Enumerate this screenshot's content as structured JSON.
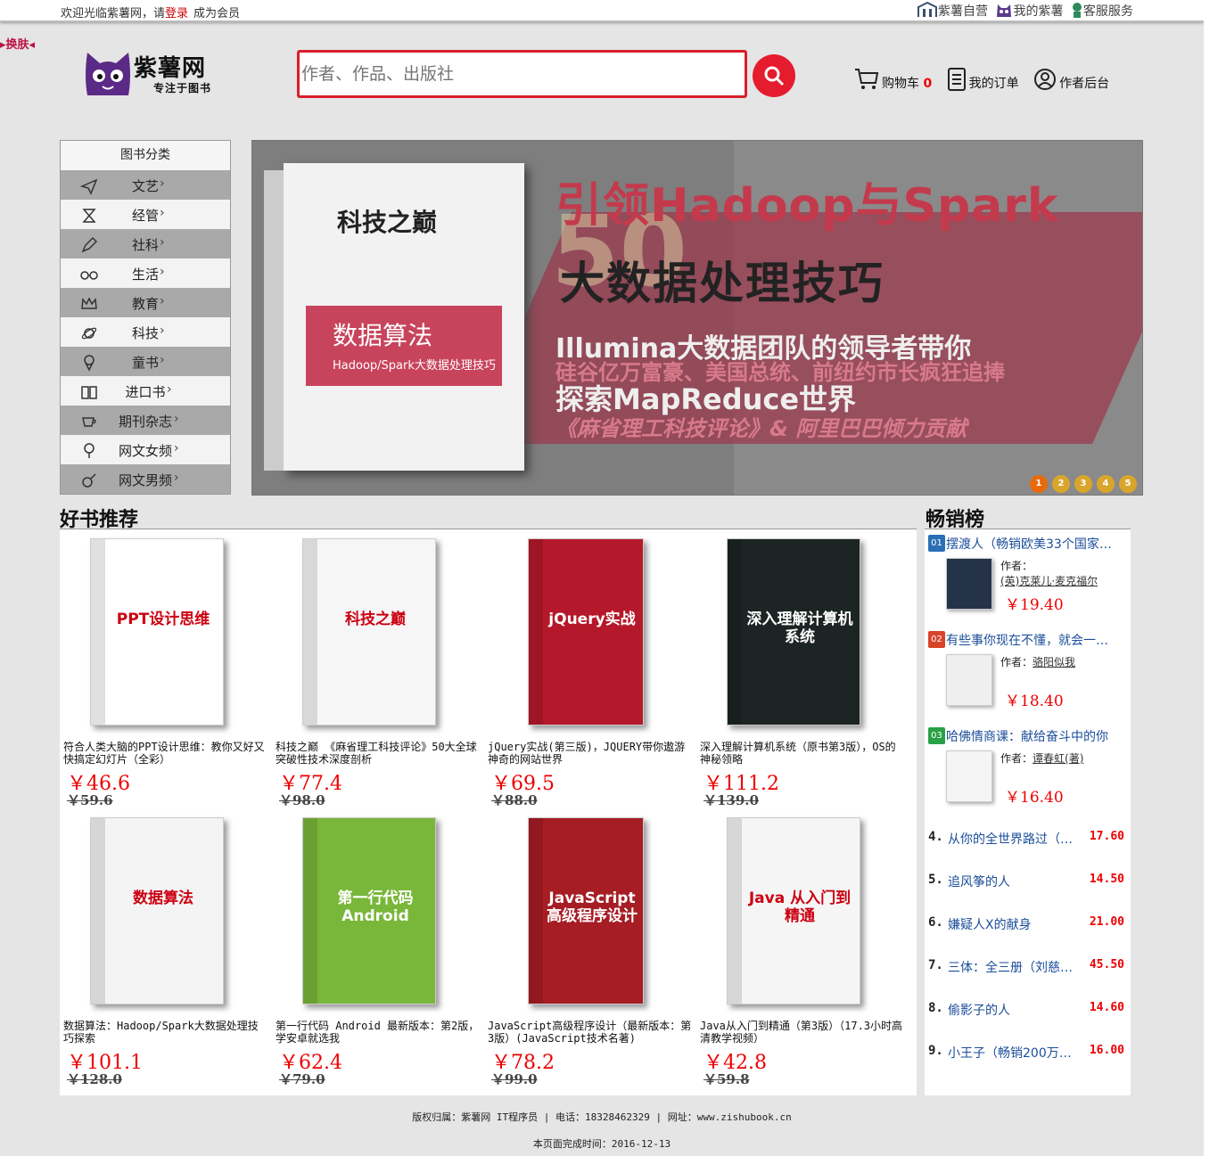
{
  "topbar": {
    "welcome_text": "欢迎光临紫薯网，请",
    "login_link": "登录",
    "register_link": "成为会员",
    "links": [
      "紫薯自营",
      "我的紫薯",
      "客服服务"
    ]
  },
  "skin_label": "换肤",
  "logo": {
    "name": "紫薯网",
    "slogan": "专注于图书"
  },
  "search": {
    "placeholder": "作者、作品、出版社"
  },
  "header_links": {
    "cart_label": "购物车",
    "cart_count": "0",
    "orders_label": "我的订单",
    "author_label": "作者后台"
  },
  "categories": {
    "title": "图书分类",
    "items": [
      {
        "label": "文艺",
        "icon": "paper-plane-icon"
      },
      {
        "label": "经管",
        "icon": "hourglass-icon"
      },
      {
        "label": "社科",
        "icon": "pen-icon"
      },
      {
        "label": "生活",
        "icon": "glasses-icon"
      },
      {
        "label": "教育",
        "icon": "crown-icon"
      },
      {
        "label": "科技",
        "icon": "planet-icon"
      },
      {
        "label": "童书",
        "icon": "ice-cream-icon"
      },
      {
        "label": "进口书",
        "icon": "open-book-icon"
      },
      {
        "label": "期刊杂志",
        "icon": "cup-icon"
      },
      {
        "label": "网文女频",
        "icon": "female-icon"
      },
      {
        "label": "网文男频",
        "icon": "male-icon"
      }
    ]
  },
  "banner": {
    "headline": "引领Hadoop与Spark",
    "big_text": "50",
    "subheadline": "大数据处理技巧",
    "line3": "Illumina大数据团队的领导者带你",
    "line4": "硅谷亿万富豪、美国总统、前纽约市长疯狂追捧",
    "line5": "探索MapReduce世界",
    "line6": "《麻省理工科技评论》& 阿里巴巴倾力贡献",
    "book_title": "科技之巅",
    "book_band_title": "数据算法",
    "book_band_sub": "Hadoop/Spark大数据处理技巧",
    "dots": [
      "1",
      "2",
      "3",
      "4",
      "5"
    ],
    "active_dot": 1
  },
  "recommend": {
    "title": "好书推荐",
    "books": [
      {
        "title": "符合人类大脑的PPT设计思维：教你又好又快搞定幻灯片（全彩）",
        "price": "￥46.6",
        "old_price": "￥59.6",
        "cover_text": "PPT设计思维",
        "cover_color": "#ffffff"
      },
      {
        "title": "科技之巅 《麻省理工科技评论》50大全球突破性技术深度剖析",
        "price": "￥77.4",
        "old_price": "￥98.0",
        "cover_text": "科技之巅",
        "cover_color": "#f6f6f6"
      },
      {
        "title": "jQuery实战(第三版)，JQUERY带你遨游神奇的网站世界",
        "price": "￥69.5",
        "old_price": "￥88.0",
        "cover_text": "jQuery实战",
        "cover_color": "#b5182a"
      },
      {
        "title": "深入理解计算机系统（原书第3版），OS的神秘领略",
        "price": "￥111.2",
        "old_price": "￥139.0",
        "cover_text": "深入理解计算机系统",
        "cover_color": "#1c2524"
      },
      {
        "title": "数据算法：Hadoop/Spark大数据处理技巧探索",
        "price": "￥101.1",
        "old_price": "￥128.0",
        "cover_text": "数据算法",
        "cover_color": "#f4f4f4"
      },
      {
        "title": "第一行代码 Android 最新版本：第2版，学安卓就选我",
        "price": "￥62.4",
        "old_price": "￥79.0",
        "cover_text": "第一行代码 Android",
        "cover_color": "#79b73a"
      },
      {
        "title": "JavaScript高级程序设计（最新版本：第3版）(JavaScript技术名著)",
        "price": "￥78.2",
        "old_price": "￥99.0",
        "cover_text": "JavaScript高级程序设计",
        "cover_color": "#a61d24"
      },
      {
        "title": "Java从入门到精通（第3版）（17.3小时高清教学视频）",
        "price": "￥42.8",
        "old_price": "￥59.8",
        "cover_text": "Java 从入门到精通",
        "cover_color": "#f5f5f5"
      }
    ]
  },
  "bestsellers": {
    "title": "畅销榜",
    "author_label": "作者：",
    "top": [
      {
        "rank": "01",
        "title": "摆渡人（畅销欧美33个国家…",
        "author": "(英)克莱儿·麦克福尔",
        "price": "￥19.40",
        "badge_color": "#2a6fb5"
      },
      {
        "rank": "02",
        "title": "有些事你现在不懂，就会一…",
        "author": "骆阳似我",
        "price": "￥18.40",
        "badge_color": "#d8442a"
      },
      {
        "rank": "03",
        "title": "哈佛情商课：献给奋斗中的你",
        "author": "谭春虹(著)",
        "price": "￥16.40",
        "badge_color": "#2aa046"
      }
    ],
    "rest": [
      {
        "rank": "4.",
        "title": "从你的全世界路过（…",
        "price": "17.60"
      },
      {
        "rank": "5.",
        "title": "追风筝的人",
        "price": "14.50"
      },
      {
        "rank": "6.",
        "title": "嫌疑人X的献身",
        "price": "21.00"
      },
      {
        "rank": "7.",
        "title": "三体：全三册（刘慈…",
        "price": "45.50"
      },
      {
        "rank": "8.",
        "title": "偷影子的人",
        "price": "14.60"
      },
      {
        "rank": "9.",
        "title": "小王子（畅销200万…",
        "price": "16.00"
      }
    ]
  },
  "footer": {
    "line1": "版权归属：紫薯网 IT程序员 | 电话：18328462329 | 网址：www.zishubook.cn",
    "line2": "本页面完成时间：2016-12-13"
  }
}
